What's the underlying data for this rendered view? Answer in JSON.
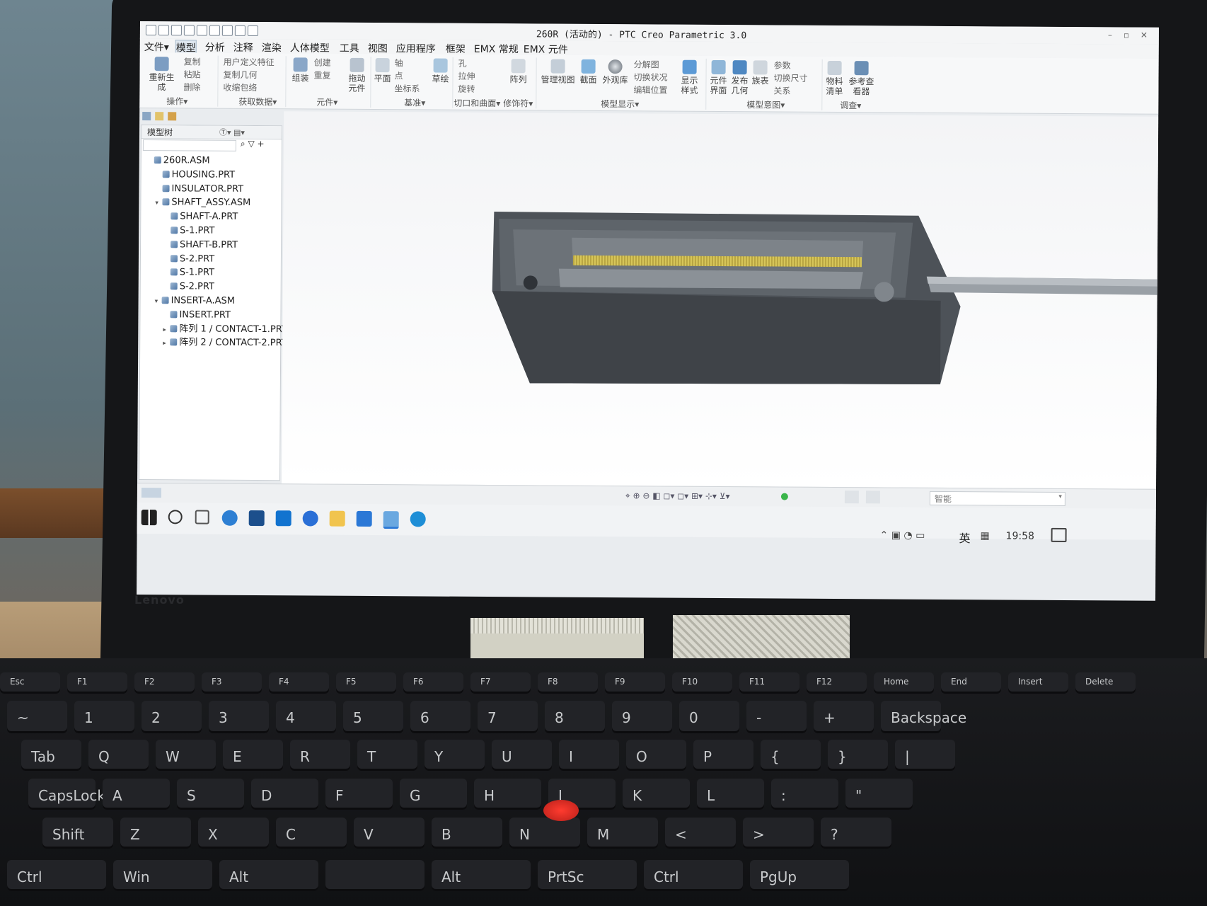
{
  "window": {
    "title": "260R (活动的) - PTC Creo Parametric 3.0"
  },
  "menu": [
    "文件▾",
    "模型",
    "分析",
    "注释",
    "渲染",
    "人体模型",
    "工具",
    "视图",
    "应用程序",
    "框架",
    "EMX 常规",
    "EMX 元件"
  ],
  "ribbon": {
    "operations": {
      "regenerate": "重新生成",
      "copy": "复制",
      "paste": "粘贴",
      "delete": "删除",
      "group": "操作▾"
    },
    "get_data": {
      "user_feature": "用户定义特征",
      "copy_geom": "复制几何",
      "shrinkwrap": "收缩包络",
      "group": "获取数据▾"
    },
    "component": {
      "assemble": "组装",
      "create": "创建",
      "repeat": "重复",
      "drag": "拖动元件",
      "group": "元件▾"
    },
    "datum": {
      "plane": "平面",
      "axis": "轴",
      "point": "点",
      "csys": "坐标系",
      "sketch": "草绘",
      "group": "基准▾"
    },
    "cut_surface": {
      "hole": "孔",
      "extrude": "拉伸",
      "revolve": "旋转",
      "group": "切口和曲面▾"
    },
    "modifiers": {
      "pattern": "阵列",
      "group": "修饰符▾"
    },
    "model_display": {
      "manage_views": "管理视图",
      "section": "截面",
      "appearance": "外观库",
      "explode": "分解图",
      "toggle_status": "切换状况",
      "edit_position": "编辑位置",
      "display_style": "显示样式",
      "group": "模型显示▾"
    },
    "model_intent": {
      "comp_interface": "元件界面",
      "publish_geom": "发布几何",
      "family_table": "族表",
      "params": "参数",
      "switch_dims": "切换尺寸",
      "relations": "关系",
      "group": "模型意图▾"
    },
    "investigate": {
      "bom": "物料清单",
      "ref_viewer": "参考查看器",
      "group": "调查▾"
    }
  },
  "model_tree": {
    "header": "模型树",
    "items": [
      {
        "label": "260R.ASM",
        "level": 0,
        "expand": ""
      },
      {
        "label": "HOUSING.PRT",
        "level": 1,
        "expand": ""
      },
      {
        "label": "INSULATOR.PRT",
        "level": 1,
        "expand": ""
      },
      {
        "label": "SHAFT_ASSY.ASM",
        "level": 1,
        "expand": "▾"
      },
      {
        "label": "SHAFT-A.PRT",
        "level": 2,
        "expand": ""
      },
      {
        "label": "S-1.PRT",
        "level": 2,
        "expand": ""
      },
      {
        "label": "SHAFT-B.PRT",
        "level": 2,
        "expand": ""
      },
      {
        "label": "S-2.PRT",
        "level": 2,
        "expand": ""
      },
      {
        "label": "S-1.PRT",
        "level": 2,
        "expand": ""
      },
      {
        "label": "S-2.PRT",
        "level": 2,
        "expand": ""
      },
      {
        "label": "INSERT-A.ASM",
        "level": 1,
        "expand": "▾"
      },
      {
        "label": "INSERT.PRT",
        "level": 2,
        "expand": ""
      },
      {
        "label": "阵列 1 / CONTACT-1.PRT",
        "level": 2,
        "expand": "▸"
      },
      {
        "label": "阵列 2 / CONTACT-2.PRT",
        "level": 2,
        "expand": "▸"
      }
    ]
  },
  "status": {
    "filter": "智能"
  },
  "taskbar": {
    "ime": "英",
    "clock": "19:58"
  },
  "laptop": {
    "brand": "Lenovo"
  },
  "keyboard": {
    "fn_row": [
      "Esc",
      "F1",
      "F2",
      "F3",
      "F4",
      "F5",
      "F6",
      "F7",
      "F8",
      "F9",
      "F10",
      "F11",
      "F12",
      "Home",
      "End",
      "Insert",
      "Delete"
    ],
    "num_row": [
      "~",
      "1",
      "2",
      "3",
      "4",
      "5",
      "6",
      "7",
      "8",
      "9",
      "0",
      "-",
      "+",
      "Backspace"
    ],
    "q_row": [
      "Tab",
      "Q",
      "W",
      "E",
      "R",
      "T",
      "Y",
      "U",
      "I",
      "O",
      "P",
      "{",
      "}",
      "|"
    ],
    "a_row": [
      "CapsLock",
      "A",
      "S",
      "D",
      "F",
      "G",
      "H",
      "J",
      "K",
      "L",
      ":",
      "\""
    ],
    "z_row": [
      "Shift",
      "Z",
      "X",
      "C",
      "V",
      "B",
      "N",
      "M",
      "<",
      ">",
      "?"
    ],
    "bottom_row": [
      "Ctrl",
      "Win",
      "Alt",
      "",
      "Alt",
      "PrtSc",
      "Ctrl",
      "PgUp"
    ]
  },
  "colors": {
    "housing": "#4d5258",
    "insulator": "#6c7278",
    "contacts": "#b8a542",
    "accent": "#3b6ea5"
  }
}
